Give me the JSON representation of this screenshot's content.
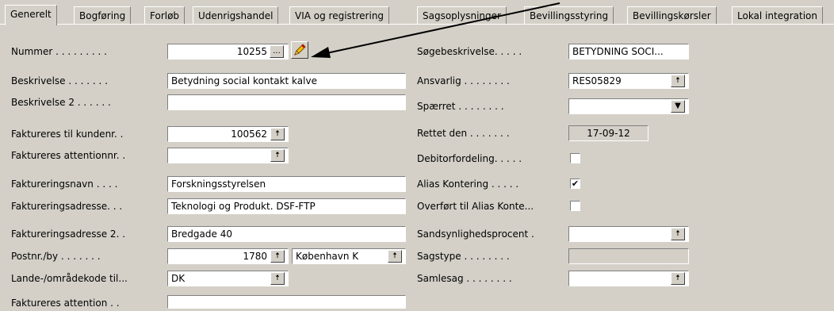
{
  "tabs": [
    "Generelt",
    "Bogføring",
    "Forløb",
    "Udenrigshandel",
    "VIA og registrering",
    "Sagsoplysninger",
    "Bevillingsstyring",
    "Bevillingskørsler",
    "Lokal integration"
  ],
  "left": {
    "nummer": {
      "label": "Nummer . . . . . . . . .",
      "value": "10255"
    },
    "beskrivelse": {
      "label": "Beskrivelse . . . . . . .",
      "value": "Betydning social kontakt kalve"
    },
    "beskrivelse2": {
      "label": "Beskrivelse 2 . . . . . .",
      "value": ""
    },
    "kundenr": {
      "label": "Faktureres til kundenr. .",
      "value": "100562"
    },
    "attentionnr": {
      "label": "Faktureres attentionnr. .",
      "value": ""
    },
    "navn": {
      "label": "Faktureringsnavn . . . .",
      "value": "Forskningsstyrelsen"
    },
    "adresse": {
      "label": "Faktureringsadresse. . .",
      "value": "Teknologi og Produkt. DSF-FTP"
    },
    "adresse2": {
      "label": "Faktureringsadresse 2. .",
      "value": "Bredgade 40"
    },
    "postnr": {
      "label": "Postnr./by . . . . . . .",
      "value": "1780",
      "city": "København K"
    },
    "lande": {
      "label": "Lande-/områdekode til...",
      "value": "DK"
    },
    "attention": {
      "label": "Faktureres attention . .",
      "value": ""
    }
  },
  "right": {
    "soegebeskrivelse": {
      "label": "Søgebeskrivelse. . . . .",
      "value": "BETYDNING SOCI..."
    },
    "ansvarlig": {
      "label": "Ansvarlig . . . . . . . .",
      "value": "RES05829"
    },
    "spaerret": {
      "label": "Spærret . . . . . . . .",
      "value": ""
    },
    "rettet": {
      "label": "Rettet den . . . . . . .",
      "value": "17-09-12"
    },
    "debitorfordeling": {
      "label": "Debitorfordeling. . . . .",
      "checked": false
    },
    "alias": {
      "label": "Alias Kontering . . . . .",
      "checked": true
    },
    "overfoert": {
      "label": "Overført til Alias Konte...",
      "checked": false
    },
    "sandsynlighed": {
      "label": "Sandsynlighedsprocent .",
      "value": ""
    },
    "sagstype": {
      "label": "Sagstype . . . . . . . .",
      "value": ""
    },
    "samlesag": {
      "label": "Samlesag . . . . . . . .",
      "value": ""
    }
  },
  "icons": {
    "assist": "ellipsis-button",
    "edit": "pencil-icon",
    "lookup": "up-arrow-icon",
    "dropdown": "down-arrow-icon",
    "check": "check-mark-icon"
  }
}
